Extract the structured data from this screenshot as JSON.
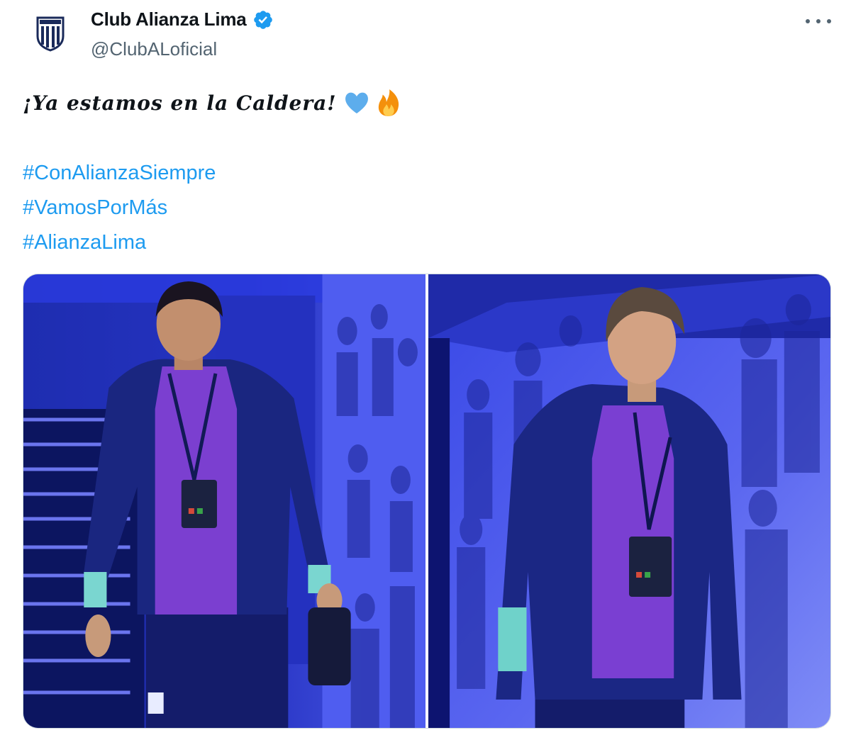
{
  "account": {
    "display_name": "Club Alianza Lima",
    "handle": "@ClubALoficial",
    "verified": true,
    "avatar_icon": "alianza-lima-crest-icon"
  },
  "menu": {
    "icon": "more-options-icon"
  },
  "post": {
    "text": "¡Ya estamos en la Caldera!",
    "emojis": [
      "blue-heart-icon",
      "fire-icon"
    ],
    "hashtags": [
      "#ConAlianzaSiempre",
      "#VamosPorMás",
      "#AlianzaLima"
    ]
  },
  "media": {
    "count": 2,
    "photos": [
      {
        "subject": "player-photo-1"
      },
      {
        "subject": "player-photo-2"
      }
    ]
  },
  "colors": {
    "link": "#1d9bf0",
    "handle": "#536471",
    "verified": "#1d9bf0",
    "photo_tint": "#2a2fd6"
  }
}
